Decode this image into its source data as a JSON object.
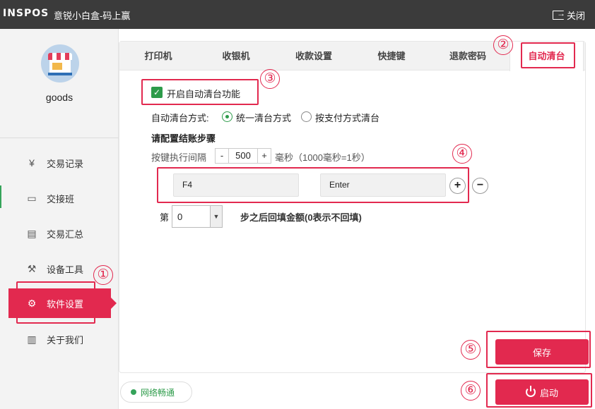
{
  "titlebar": {
    "logo": "INSPOS",
    "title": "意锐小白盒-码上赢",
    "close_label": "关闭"
  },
  "user": {
    "name": "goods"
  },
  "sidebar": {
    "items": [
      {
        "label": "交易记录",
        "icon": "receipt-icon"
      },
      {
        "label": "交接班",
        "icon": "monitor-icon"
      },
      {
        "label": "交易汇总",
        "icon": "document-icon"
      },
      {
        "label": "设备工具",
        "icon": "tools-icon"
      },
      {
        "label": "软件设置",
        "icon": "gear-icon",
        "active": true
      },
      {
        "label": "关于我们",
        "icon": "book-icon"
      }
    ]
  },
  "tabs": [
    {
      "label": "打印机"
    },
    {
      "label": "收银机"
    },
    {
      "label": "收款设置"
    },
    {
      "label": "快捷键"
    },
    {
      "label": "退款密码"
    },
    {
      "label": "自动清台",
      "active": true
    }
  ],
  "settings": {
    "enable_label": "开启自动清台功能",
    "enabled": true,
    "mode_label": "自动清台方式:",
    "mode_options": [
      "统一清台方式",
      "按支付方式清台"
    ],
    "mode_selected": "统一清台方式",
    "steps_title": "请配置结账步骤",
    "interval_label": "按键执行间隔",
    "interval_minus": "-",
    "interval_value": "500",
    "interval_plus": "+",
    "interval_unit": "毫秒（1000毫秒=1秒）",
    "keys": [
      "F4",
      "Enter"
    ],
    "add_symbol": "+",
    "remove_symbol": "−",
    "step_prefix": "第",
    "step_value": "0",
    "step_suffix": "步之后回填金额(0表示不回填)"
  },
  "buttons": {
    "save": "保存",
    "start": "启动"
  },
  "status": {
    "network": "网络畅通"
  },
  "annotations": [
    "①",
    "②",
    "③",
    "④",
    "⑤",
    "⑥"
  ],
  "colors": {
    "accent": "#e2294f",
    "check": "#2d9b4a",
    "titlebar": "#3b3b3b"
  }
}
